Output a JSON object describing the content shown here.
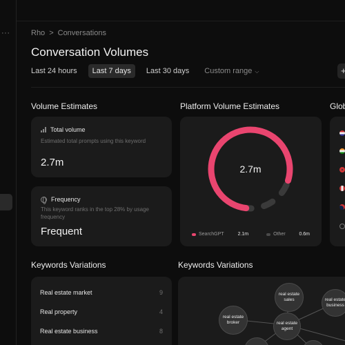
{
  "sidebar": {
    "more_glyph": "···"
  },
  "breadcrumb": {
    "root": "Rho",
    "separator": ">",
    "current": "Conversations"
  },
  "page": {
    "title": "Conversation Volumes"
  },
  "time_tabs": [
    "Last 24 hours",
    "Last 7 days",
    "Last 30 days",
    "Custom range"
  ],
  "active_tab": "Last 7 days",
  "plus_glyph": "+",
  "sections": {
    "volume_estimates": "Volume Estimates",
    "platform_volume": "Platform Volume Estimates",
    "global": "Glob",
    "keywords_list": "Keywords Variations",
    "keywords_graph": "Keywords Variations"
  },
  "total_volume": {
    "icon": "bar-chart-icon",
    "label": "Total volume",
    "description": "Estimated total prompts using this keyword",
    "value": "2.7m"
  },
  "frequency": {
    "icon": "globe-icon",
    "label": "Frequency",
    "description": "This keyword ranks in the top 28% by usage frequency",
    "value": "Frequent"
  },
  "platform_donut": {
    "center_value": "2.7m",
    "segments": [
      {
        "name": "SearchGPT",
        "value": "2.1m",
        "fraction": 0.78,
        "color": "#e9456f"
      },
      {
        "name": "Other",
        "value": "0.6m",
        "fraction": 0.22,
        "color": "#3a3a3a"
      }
    ]
  },
  "global_flags": [
    "us-flag-icon",
    "in-flag-icon",
    "gb-flag-icon",
    "ca-flag-icon",
    "au-flag-icon",
    "globe-icon"
  ],
  "keywords": [
    {
      "label": "Real estate market",
      "count": "9"
    },
    {
      "label": "Real property",
      "count": "4"
    },
    {
      "label": "Real estate business",
      "count": "8"
    }
  ],
  "keyword_bubbles": [
    {
      "label": "real estate sales"
    },
    {
      "label": "real estate business"
    },
    {
      "label": "real estate broker"
    },
    {
      "label": "real estate agent"
    },
    {
      "label": ""
    },
    {
      "label": ""
    }
  ],
  "colors": {
    "accent": "#e9456f",
    "background": "#0d0d0d",
    "card": "#1b1b1b"
  }
}
